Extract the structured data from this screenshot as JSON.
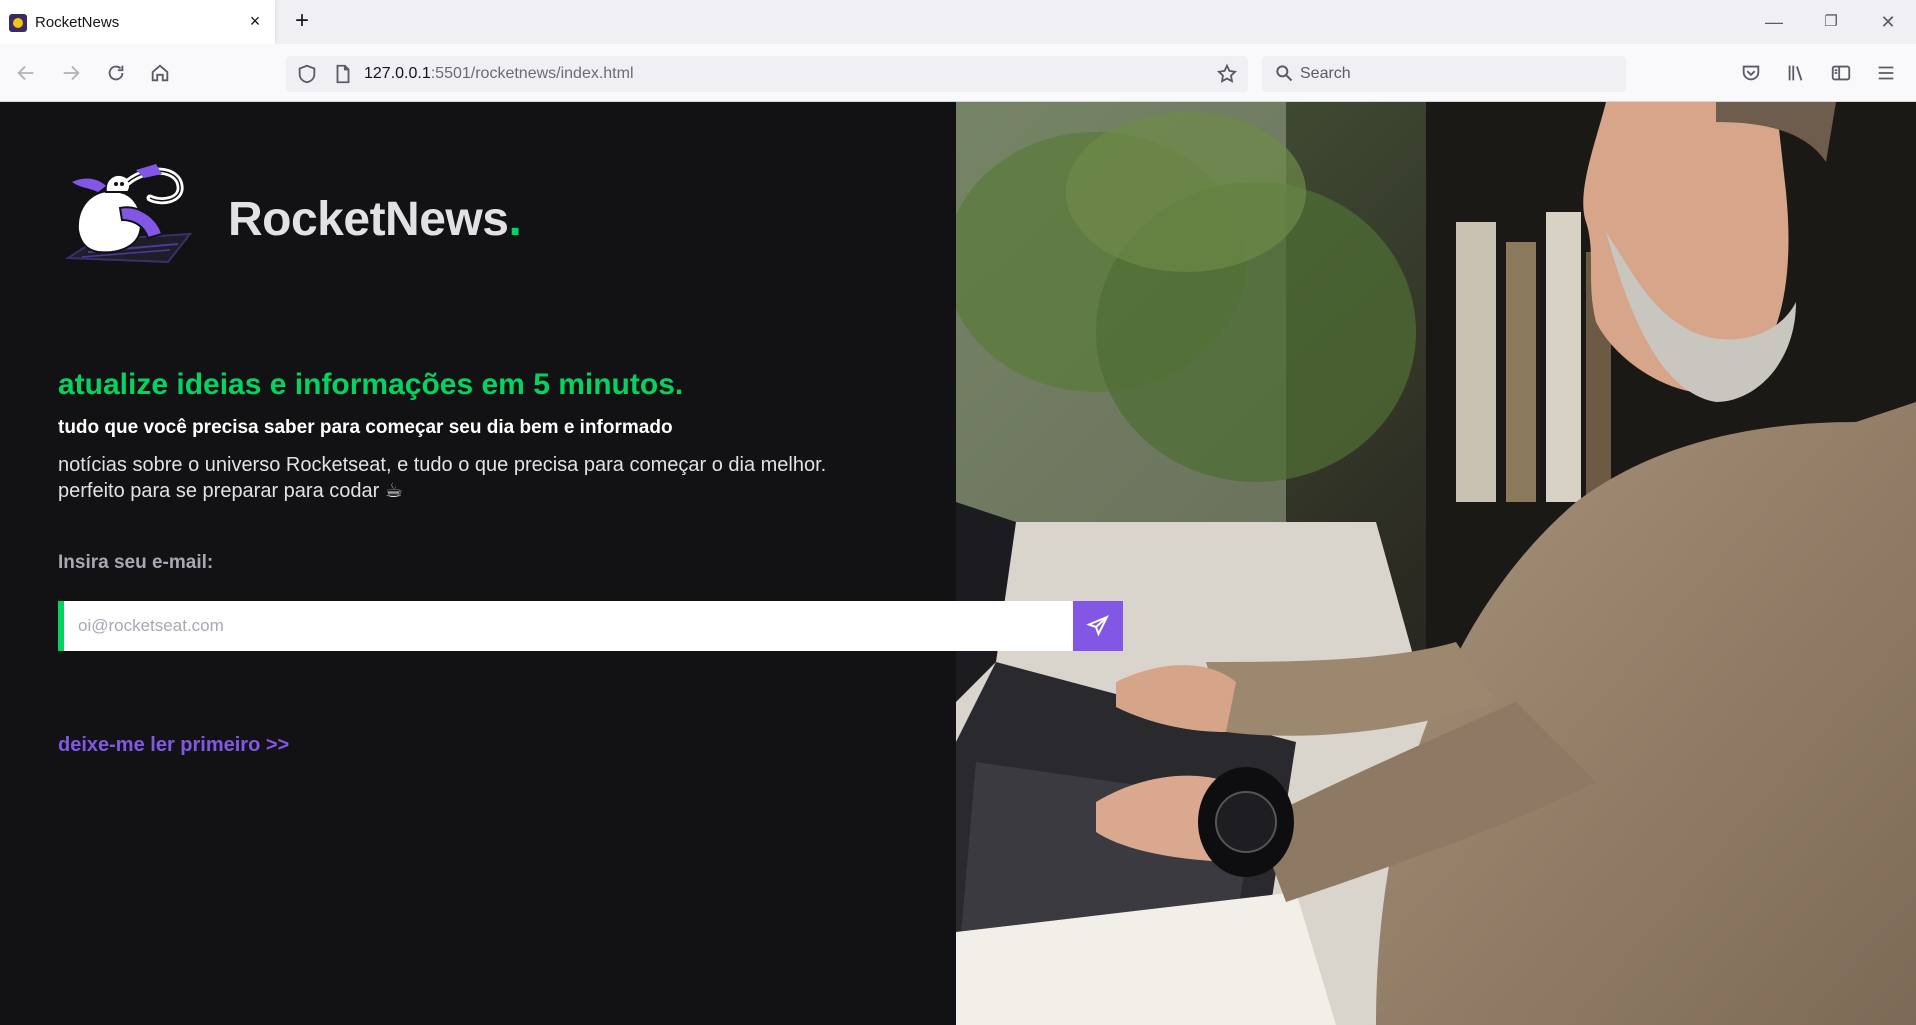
{
  "browser": {
    "tab_title": "RocketNews",
    "tab_close": "×",
    "new_tab": "+",
    "url_host": "127.0.0.1",
    "url_rest": ":5501/rocketnews/index.html",
    "search_placeholder": "Search",
    "window_minimize": "—",
    "window_restore": "❐",
    "window_close": "✕"
  },
  "header": {
    "brand_name": "RocketNews",
    "brand_dot": "."
  },
  "hero": {
    "headline": "atualize ideias e informações em 5 minutos.",
    "subheadline": "tudo que você precisa saber para começar seu dia bem e informado",
    "description_line1": "notícias sobre o universo Rocketseat, e tudo o que precisa para começar o dia melhor.",
    "description_line2": "perfeito para se preparar para codar ☕"
  },
  "form": {
    "email_label": "Insira seu e-mail:",
    "email_placeholder": "oi@rocketseat.com",
    "email_value": ""
  },
  "links": {
    "read_first": "deixe-me ler primeiro >>"
  },
  "colors": {
    "background": "#121214",
    "accent_green": "#04d361",
    "accent_purple": "#8257e5",
    "text_light": "#e1e1e6",
    "text_muted": "#a8a8b3"
  },
  "icons": [
    "shield-icon",
    "page-icon",
    "star-icon",
    "search-icon",
    "back-icon",
    "forward-icon",
    "reload-icon",
    "home-icon",
    "pocket-icon",
    "library-icon",
    "sidebar-icon",
    "menu-icon",
    "send-icon"
  ]
}
